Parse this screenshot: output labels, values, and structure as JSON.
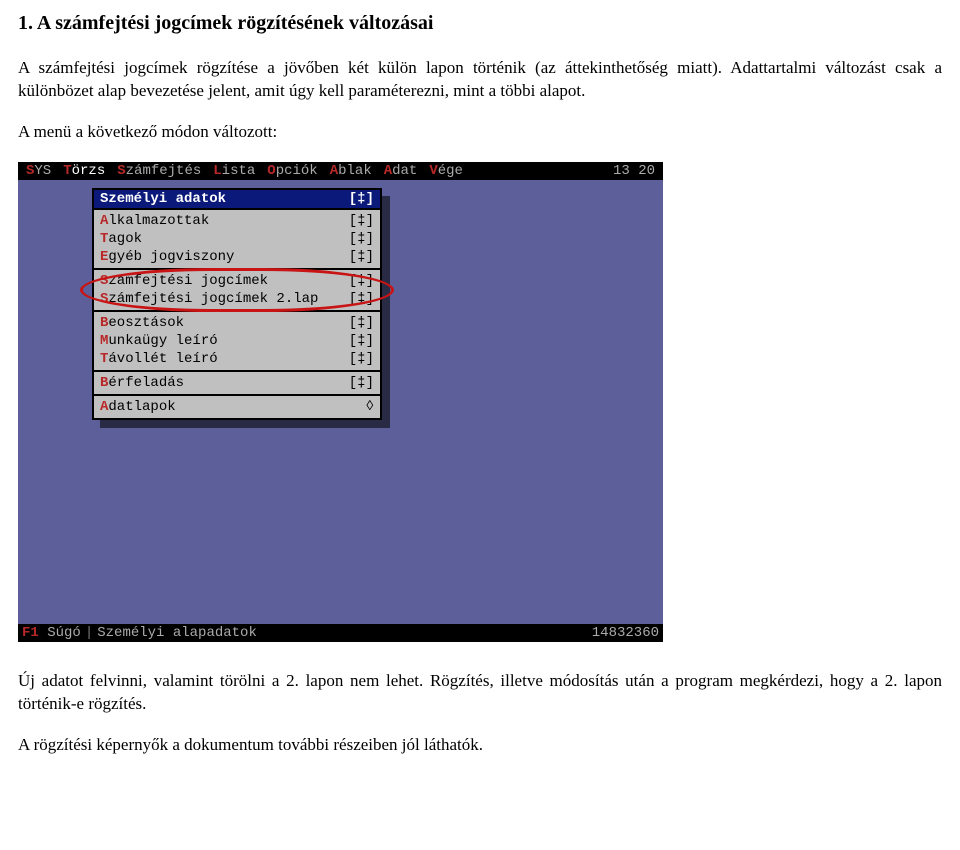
{
  "doc": {
    "title": "1. A számfejtési jogcímek rögzítésének változásai",
    "p1": "A számfejtési jogcímek rögzítése a jövőben két külön lapon történik (az áttekinthetőség miatt). Adattartalmi változást csak a különbözet alap bevezetése jelent, amit úgy kell paraméterezni, mint a többi alapot.",
    "p2": "A menü a következő módon változott:",
    "p3": "Új adatot felvinni, valamint törölni a 2. lapon nem lehet. Rögzítés, illetve módosítás után a program megkérdezi, hogy a 2. lapon történik-e rögzítés.",
    "p4": "A rögzítési képernyők a dokumentum további részeiben jól láthatók."
  },
  "menubar": {
    "items": [
      {
        "hot": "S",
        "rest": "YS"
      },
      {
        "hot": "T",
        "rest": "örzs"
      },
      {
        "hot": "S",
        "rest": "zámfejtés"
      },
      {
        "hot": "L",
        "rest": "ista"
      },
      {
        "hot": "O",
        "rest": "pciók"
      },
      {
        "hot": "A",
        "rest": "blak"
      },
      {
        "hot": "A",
        "rest": "dat"
      },
      {
        "hot": "V",
        "rest": "ége"
      }
    ],
    "clock": "13 20"
  },
  "panel": {
    "header": "Személyi adatok",
    "header_tag": "[‡]",
    "groups": [
      [
        {
          "hot": "A",
          "rest": "lkalmazottak",
          "tag": "[‡]"
        },
        {
          "hot": "T",
          "rest": "agok",
          "tag": "[‡]"
        },
        {
          "hot": "E",
          "rest": "gyéb jogviszony",
          "tag": "[‡]"
        }
      ],
      [
        {
          "hot": "S",
          "rest": "zámfejtési jogcímek",
          "tag": "[‡]"
        },
        {
          "hot": "S",
          "rest": "zámfejtési jogcímek 2.lap",
          "tag": "[‡]"
        }
      ],
      [
        {
          "hot": "B",
          "rest": "eosztások",
          "tag": "[‡]"
        },
        {
          "hot": "M",
          "rest": "unkaügy leíró",
          "tag": "[‡]"
        },
        {
          "hot": "T",
          "rest": "ávollét leíró",
          "tag": "[‡]"
        }
      ],
      [
        {
          "hot": "B",
          "rest": "érfeladás",
          "tag": "[‡]"
        }
      ],
      [
        {
          "hot": "A",
          "rest": "datlapok",
          "tag": "◊"
        }
      ]
    ]
  },
  "statusbar": {
    "key": "F1",
    "key_label": "Súgó",
    "context": "Személyi alapadatok",
    "pos": "14832360"
  }
}
